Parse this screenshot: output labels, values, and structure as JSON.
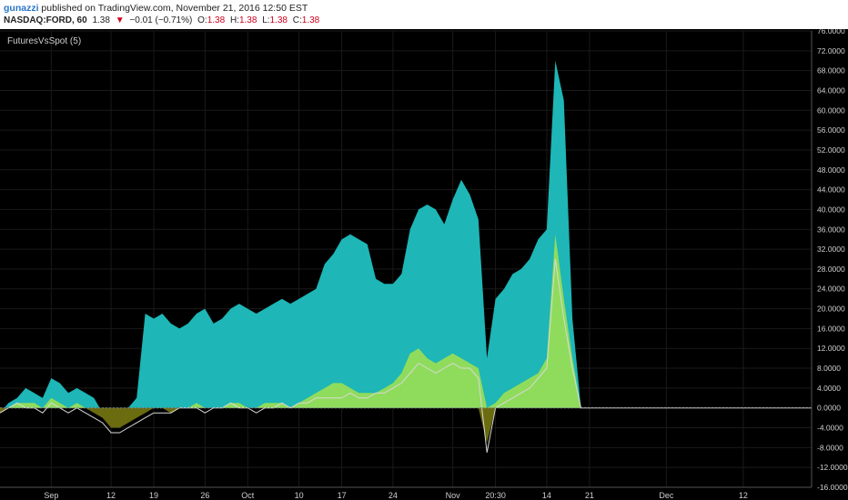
{
  "header": {
    "user": "gunazzi",
    "published": "published on TradingView.com, November 21, 2016 12:50 EST",
    "symbol": "NASDAQ:FORD, 60",
    "last": "1.38",
    "change_arrow": "▼",
    "change": "−0.01 (−0.71%)",
    "o_label": "O:",
    "o_value": "1.38",
    "h_label": "H:",
    "h_value": "1.38",
    "l_label": "L:",
    "l_value": "1.38",
    "c_label": "C:",
    "c_value": "1.38"
  },
  "colors": {
    "background": "#000000",
    "spread": "#1eb6b6",
    "positive": "#8fdc5c",
    "negative": "#6b6b10",
    "line": "#d8d8d8",
    "header_red": "#d0021b",
    "user_blue": "#2a77c9"
  },
  "chart_data": {
    "type": "area",
    "indicator_label": "FuturesVsSpot (5)",
    "ylim": [
      -16,
      76
    ],
    "y_ticks": [
      76,
      72,
      68,
      64,
      60,
      56,
      52,
      48,
      44,
      40,
      36,
      32,
      28,
      24,
      20,
      16,
      12,
      8,
      4,
      0,
      -4,
      -8,
      -12,
      -16
    ],
    "y_tick_labels": [
      "76.0000",
      "72.0000",
      "68.0000",
      "64.0000",
      "60.0000",
      "56.0000",
      "52.0000",
      "48.0000",
      "44.0000",
      "40.0000",
      "36.0000",
      "32.0000",
      "28.0000",
      "24.0000",
      "20.0000",
      "16.0000",
      "12.0000",
      "8.0000",
      "4.0000",
      "0.0000",
      "-4.0000",
      "-8.0000",
      "-12.0000",
      "-16.0000"
    ],
    "x_tick_labels": [
      "Sep",
      "12",
      "19",
      "26",
      "Oct",
      "10",
      "17",
      "24",
      "Nov",
      "20:30",
      "14",
      "21",
      "Dec",
      "12"
    ],
    "x_tick_index": [
      6,
      13,
      18,
      24,
      29,
      35,
      40,
      46,
      53,
      58,
      64,
      69,
      78,
      87
    ],
    "x_count": 96,
    "series": [
      {
        "values": [
          -1,
          1,
          2,
          4,
          3,
          2,
          6,
          5,
          3,
          4,
          3,
          2,
          -1,
          -3,
          -2,
          0,
          2,
          19,
          18,
          19,
          17,
          16,
          17,
          19,
          20,
          17,
          18,
          20,
          21,
          20,
          19,
          20,
          21,
          22,
          21,
          22,
          23,
          24,
          29,
          31,
          34,
          35,
          34,
          33,
          26,
          25,
          25,
          27,
          36,
          40,
          41,
          40,
          37,
          42,
          46,
          43,
          38,
          10,
          22,
          24,
          27,
          28,
          30,
          34,
          36,
          70,
          62,
          18,
          0,
          0,
          0,
          0,
          0,
          0,
          0,
          0,
          0,
          0,
          0,
          0,
          0,
          0,
          0,
          0,
          0,
          0,
          0,
          0,
          0,
          0,
          0,
          0,
          0,
          0,
          0,
          0
        ]
      },
      {
        "values": [
          -1,
          0,
          1,
          1,
          1,
          0,
          2,
          1,
          0,
          1,
          0,
          -1,
          -2,
          -4,
          -4,
          -3,
          -2,
          -1,
          0,
          0,
          -1,
          0,
          0,
          1,
          0,
          0,
          0,
          1,
          1,
          0,
          0,
          1,
          1,
          1,
          0,
          1,
          2,
          3,
          4,
          5,
          5,
          4,
          3,
          3,
          3,
          4,
          5,
          7,
          11,
          12,
          10,
          9,
          10,
          11,
          10,
          9,
          8,
          -7,
          1,
          3,
          4,
          5,
          6,
          7,
          10,
          35,
          22,
          10,
          0,
          0,
          0,
          0,
          0,
          0,
          0,
          0,
          0,
          0,
          0,
          0,
          0,
          0,
          0,
          0,
          0,
          0,
          0,
          0,
          0,
          0,
          0,
          0,
          0,
          0,
          0,
          0
        ]
      },
      {
        "values": [
          -1,
          0,
          1,
          0,
          0,
          -1,
          1,
          0,
          -1,
          0,
          -1,
          -2,
          -3,
          -5,
          -5,
          -4,
          -3,
          -2,
          -1,
          -1,
          -1,
          0,
          0,
          0,
          -1,
          0,
          0,
          1,
          0,
          0,
          -1,
          0,
          0,
          1,
          0,
          1,
          1,
          2,
          2,
          2,
          2,
          3,
          2,
          2,
          3,
          3,
          4,
          5,
          7,
          9,
          8,
          7,
          8,
          9,
          8,
          8,
          6,
          -9,
          0,
          1,
          2,
          3,
          4,
          6,
          8,
          30,
          18,
          8,
          0,
          0,
          0,
          0,
          0,
          0,
          0,
          0,
          0,
          0,
          0,
          0,
          0,
          0,
          0,
          0,
          0,
          0,
          0,
          0,
          0,
          0,
          0,
          0,
          0,
          0,
          0,
          0
        ]
      }
    ]
  }
}
